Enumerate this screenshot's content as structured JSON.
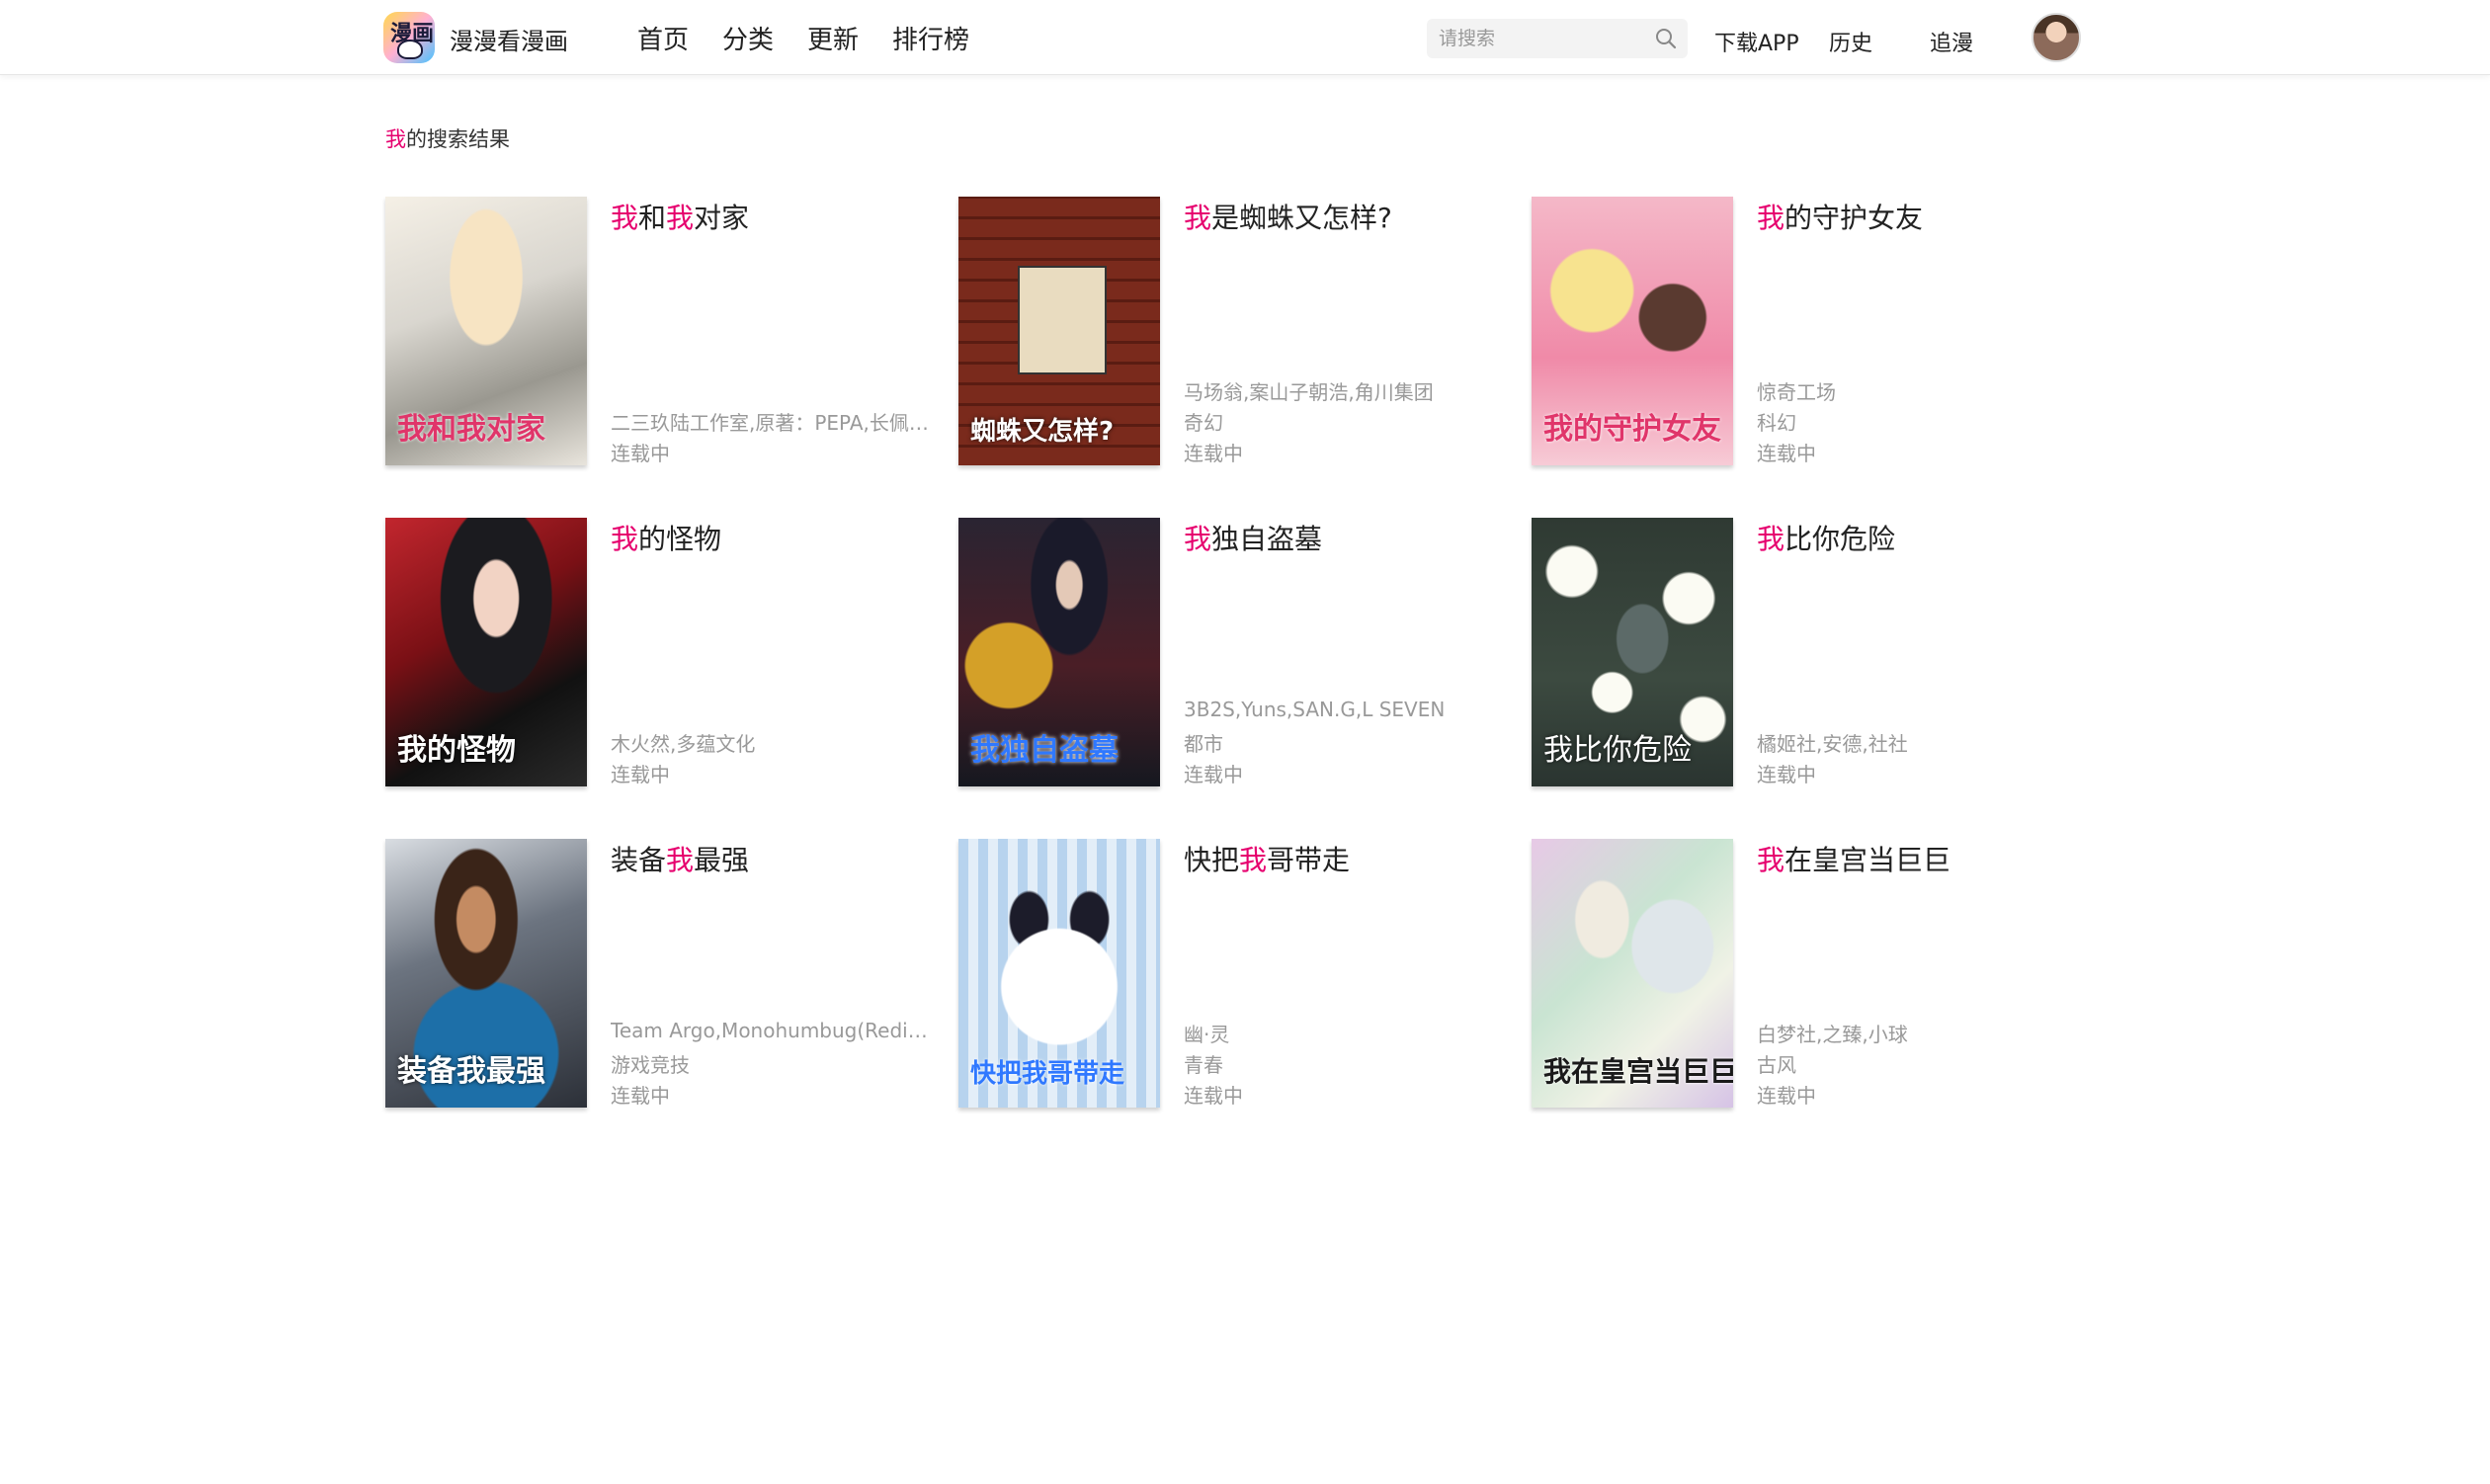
{
  "header": {
    "site_name": "漫漫看漫画",
    "logo_text": "漫画",
    "nav": [
      "首页",
      "分类",
      "更新",
      "排行榜"
    ],
    "search_placeholder": "请搜索",
    "links": {
      "download": "下载APP",
      "history": "历史",
      "follow": "追漫"
    }
  },
  "search": {
    "keyword": "我",
    "suffix": "的搜索结果"
  },
  "colors": {
    "highlight": "#e6006e",
    "meta": "#999999"
  },
  "results": [
    {
      "pre": "",
      "kw": "我",
      "mid": "和",
      "kw2": "我",
      "post": "对家",
      "meta": [
        "",
        "二三玖陆工作室,原著：PEPA,长佩文...",
        "连载中"
      ],
      "cover_text": "我和我对家"
    },
    {
      "pre": "",
      "kw": "我",
      "mid": "是蜘蛛又怎样?",
      "kw2": "",
      "post": "",
      "meta": [
        "马场翁,案山子朝浩,角川集团",
        "奇幻",
        "连载中"
      ],
      "cover_text": "蜘蛛又怎样?"
    },
    {
      "pre": "",
      "kw": "我",
      "mid": "的守护女友",
      "kw2": "",
      "post": "",
      "meta": [
        "惊奇工场",
        "科幻",
        "连载中"
      ],
      "cover_text": "我的守护女友"
    },
    {
      "pre": "",
      "kw": "我",
      "mid": "的怪物",
      "kw2": "",
      "post": "",
      "meta": [
        "",
        "木火然,多蕴文化",
        "连载中"
      ],
      "cover_text": "我的怪物"
    },
    {
      "pre": "",
      "kw": "我",
      "mid": "独自盗墓",
      "kw2": "",
      "post": "",
      "meta": [
        "3B2S,Yuns,SAN.G,L SEVEN",
        "都市",
        "连载中"
      ],
      "cover_text": "我独自盗墓"
    },
    {
      "pre": "",
      "kw": "我",
      "mid": "比你危险",
      "kw2": "",
      "post": "",
      "meta": [
        "",
        "橘姬社,安德,社社",
        "连载中"
      ],
      "cover_text": "我比你危险"
    },
    {
      "pre": "装备",
      "kw": "我",
      "mid": "最强",
      "kw2": "",
      "post": "",
      "meta": [
        "Team Argo,Monohumbug(Redice...",
        "游戏竞技",
        "连载中"
      ],
      "cover_text": "装备我最强"
    },
    {
      "pre": "快把",
      "kw": "我",
      "mid": "哥带走",
      "kw2": "",
      "post": "",
      "meta": [
        "幽·灵",
        "青春",
        "连载中"
      ],
      "cover_text": "快把我哥带走"
    },
    {
      "pre": "",
      "kw": "我",
      "mid": "在皇宫当巨巨",
      "kw2": "",
      "post": "",
      "meta": [
        "白梦社,之臻,小球",
        "古风",
        "连载中"
      ],
      "cover_text": "我在皇宫当巨巨"
    }
  ]
}
